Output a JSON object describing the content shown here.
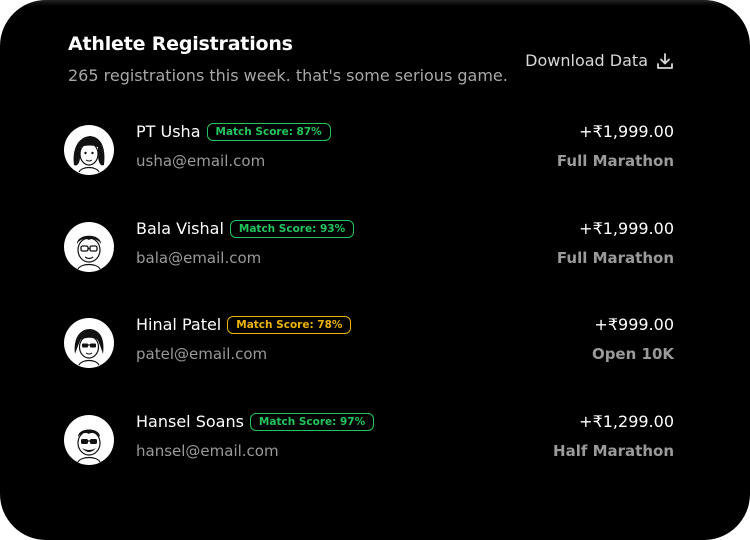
{
  "header": {
    "title": "Athlete Registrations",
    "subtitle": "265 registrations this week. that's some serious game.",
    "download_label": "Download Data"
  },
  "colors": {
    "green_badge": "#22c55e",
    "yellow_badge": "#eab308"
  },
  "registrations": [
    {
      "name": "PT Usha",
      "badge": "Match Score: 87%",
      "badge_color": "green",
      "email": "usha@email.com",
      "amount": "+₹1,999.00",
      "event": "Full Marathon"
    },
    {
      "name": "Bala Vishal",
      "badge": "Match Score: 93%",
      "badge_color": "green",
      "email": "bala@email.com",
      "amount": "+₹1,999.00",
      "event": "Full Marathon"
    },
    {
      "name": "Hinal Patel",
      "badge": "Match Score: 78%",
      "badge_color": "yellow",
      "email": "patel@email.com",
      "amount": "+₹999.00",
      "event": "Open 10K"
    },
    {
      "name": "Hansel Soans",
      "badge": "Match Score: 97%",
      "badge_color": "green",
      "email": "hansel@email.com",
      "amount": "+₹1,299.00",
      "event": "Half Marathon"
    }
  ]
}
